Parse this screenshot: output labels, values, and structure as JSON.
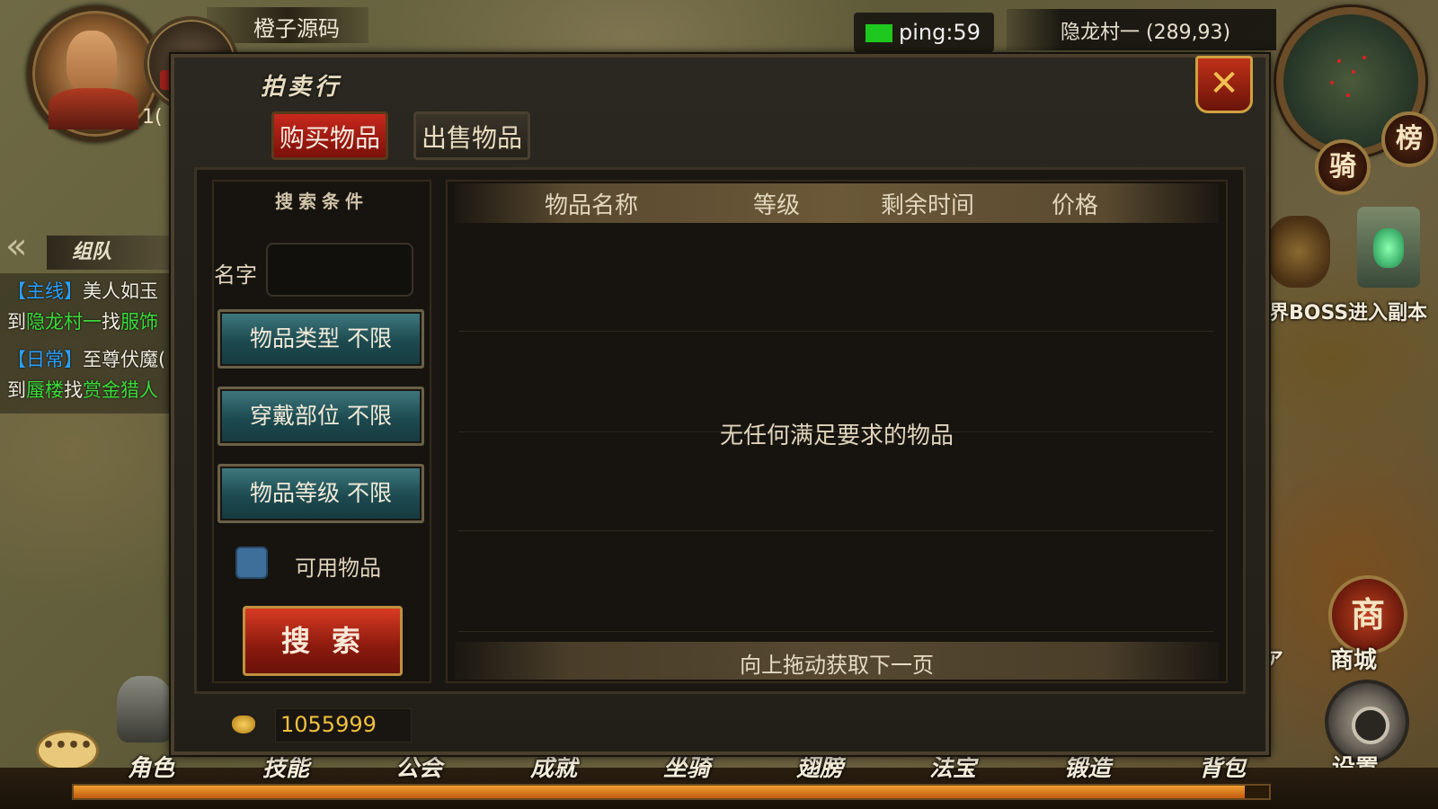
{
  "hud": {
    "player_name": "橙子源码",
    "level_partial": "1(",
    "guild_stars": "★★★",
    "ping": "ping:59",
    "map_location": "隐龙村一 (289,93)",
    "rank_button": "榜",
    "mount_button": "骑",
    "world_boss_label": "界BOSS",
    "dungeon_label": "进入副本",
    "shop_icon": "商",
    "shop_label": "商城",
    "shop_partial": "ア",
    "settings_label": "设置",
    "team_tab": "组队",
    "collapse_icon": "«",
    "chat_icon": "••••"
  },
  "quests": [
    {
      "tag": "【主线】",
      "title": "美人如玉",
      "line2_prefix": "到",
      "place": "隐龙村一",
      "mid": "找",
      "target": "服饰"
    },
    {
      "tag": "【日常】",
      "title": "至尊伏魔(",
      "line2_prefix": "到",
      "place": "蜃楼",
      "mid": "找",
      "target": "赏金猎人"
    }
  ],
  "bottom_tabs": [
    "角色",
    "技能",
    "公会",
    "成就",
    "坐骑",
    "翅膀",
    "法宝",
    "锻造",
    "背包"
  ],
  "exp_fraction": 0.98,
  "auction": {
    "title": "拍卖行",
    "close_icon": "✕",
    "tabs": {
      "buy": "购买物品",
      "sell": "出售物品"
    },
    "filters": {
      "title": "搜索条件",
      "name_label": "名字",
      "name_value": "",
      "item_type": "物品类型 不限",
      "slot": "穿戴部位 不限",
      "item_level": "物品等级 不限",
      "usable_label": "可用物品",
      "search_button": "搜索"
    },
    "columns": [
      "物品名称",
      "等级",
      "剩余时间",
      "价格"
    ],
    "empty_message": "无任何满足要求的物品",
    "page_hint": "向上拖动获取下一页",
    "gold_amount": "1055999"
  },
  "colors": {
    "buy_tab": "#c8281c",
    "filter_button": "#2a5a60",
    "search_button": "#b02a16",
    "gold_text": "#f0c040",
    "ping_indicator": "#1ec81e",
    "quest_tag": "#2aa0ff",
    "quest_place": "#3adc3a"
  }
}
